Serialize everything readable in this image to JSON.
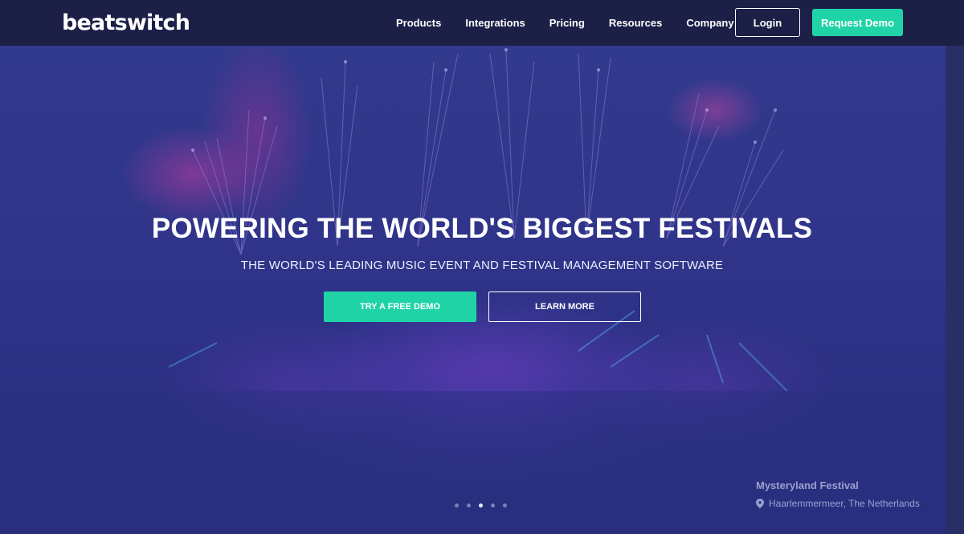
{
  "header": {
    "logo": "beatswitch",
    "nav": [
      "Products",
      "Integrations",
      "Pricing",
      "Resources",
      "Company"
    ],
    "login_label": "Login",
    "request_demo_label": "Request Demo"
  },
  "hero": {
    "title": "POWERING THE WORLD'S BIGGEST FESTIVALS",
    "subtitle": "THE WORLD'S LEADING MUSIC EVENT AND FESTIVAL MANAGEMENT SOFTWARE",
    "cta_primary": "TRY A FREE DEMO",
    "cta_secondary": "LEARN MORE"
  },
  "carousel": {
    "slide_count": 5,
    "active_index": 2
  },
  "caption": {
    "event_name": "Mysteryland Festival",
    "location_icon": "map-pin-icon",
    "location": "Haarlemmermeer, The Netherlands"
  },
  "colors": {
    "nav_bg": "#1c2047",
    "accent": "#1fd3a7",
    "hero_overlay": "#2f3489"
  }
}
